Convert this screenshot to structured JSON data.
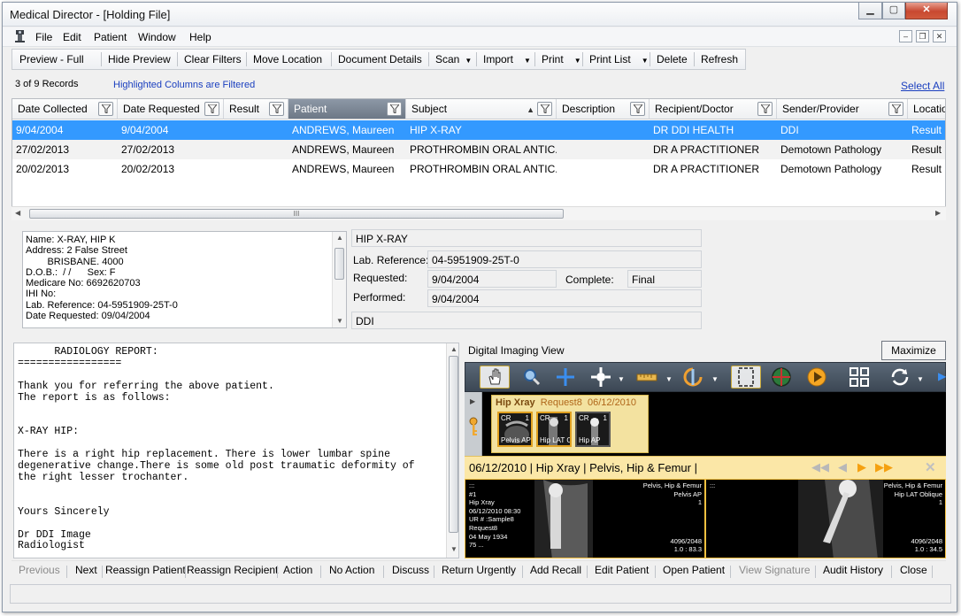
{
  "window": {
    "title": "Medical Director - [Holding File]"
  },
  "menu": [
    "File",
    "Edit",
    "Patient",
    "Window",
    "Help"
  ],
  "toolbar": {
    "preview": "Preview - Full",
    "hide_preview": "Hide Preview",
    "clear_filters": "Clear Filters",
    "move_location": "Move Location",
    "document_details": "Document Details",
    "scan": "Scan",
    "import": "Import",
    "print": "Print",
    "print_list": "Print List",
    "delete": "Delete",
    "refresh": "Refresh"
  },
  "records": {
    "count_text": "3 of 9 Records",
    "filter_note": "Highlighted Columns are Filtered",
    "select_all": "Select All"
  },
  "grid": {
    "columns": [
      "Date Collected",
      "Date Requested",
      "Result",
      "Patient",
      "Subject",
      "Description",
      "Recipient/Doctor",
      "Sender/Provider",
      "Location"
    ],
    "rows": [
      [
        "9/04/2004",
        "9/04/2004",
        "",
        "ANDREWS, Maureen",
        "HIP X-RAY",
        "",
        "DR DDI HEALTH",
        "DDI",
        "Result"
      ],
      [
        "27/02/2013",
        "27/02/2013",
        "",
        "ANDREWS, Maureen",
        "PROTHROMBIN ORAL ANTIC...",
        "",
        "DR A PRACTITIONER",
        "Demotown Pathology",
        "Result"
      ],
      [
        "20/02/2013",
        "20/02/2013",
        "",
        "ANDREWS, Maureen",
        "PROTHROMBIN ORAL ANTIC...",
        "",
        "DR A PRACTITIONER",
        "Demotown Pathology",
        "Result"
      ]
    ],
    "scroll_grip": "III"
  },
  "patient_info": [
    "Name: X-RAY, HIP K",
    "Address: 2 False Street",
    "        BRISBANE. 4000",
    "D.O.B.:  / /      Sex: F",
    "Medicare No: 6692620703",
    "IHI No:",
    "Lab. Reference: 04-5951909-25T-0",
    "Date Requested: 09/04/2004"
  ],
  "details": {
    "subject": "HIP X-RAY",
    "lab_ref_label": "Lab. Reference:",
    "lab_ref": "04-5951909-25T-0",
    "requested_label": "Requested:",
    "requested": "9/04/2004",
    "complete_label": "Complete:",
    "complete": "Final",
    "performed_label": "Performed:",
    "performed": "9/04/2004",
    "provider": "DDI"
  },
  "report": "      RADIOLOGY REPORT:\n=================\n\nThank you for referring the above patient.\nThe report is as follows:\n\n\nX-RAY HIP:\n\nThere is a right hip replacement. There is lower lumbar spine\ndegenerative change.There is some old post traumatic deformity of\nthe right lesser trochanter.\n\n\nYours Sincerely\n\nDr DDI Image\nRadiologist",
  "imaging": {
    "label": "Digital Imaging View",
    "maximize": "Maximize",
    "series_title": "Hip Xray",
    "series_request": "Request8",
    "series_date": "06/12/2010",
    "thumbs": [
      {
        "mod": "CR",
        "num": "1",
        "caption": "Pelvis AP"
      },
      {
        "mod": "CR",
        "num": "1",
        "caption": "Hip LAT O"
      },
      {
        "mod": "CR",
        "num": "1",
        "caption": "Hip AP"
      }
    ],
    "viewer_caption": "06/12/2010 | Hip Xray | Pelvis, Hip & Femur |",
    "left_pane": {
      "tl": [
        ":::",
        "#1",
        "Hip Xray",
        "06/12/2010 08:30",
        "UR # :Sample8",
        "Request8",
        "04 May 1934",
        "75 ..."
      ],
      "tr": [
        "Pelvis, Hip & Femur",
        "Pelvis AP",
        "1"
      ],
      "br": [
        "4096/2048",
        "1.0 : 83.3"
      ]
    },
    "right_pane": {
      "tl": [
        ":::"
      ],
      "tr": [
        "Pelvis, Hip & Femur",
        "Hip LAT Oblique",
        "1"
      ],
      "br": [
        "4096/2048",
        "1.0 : 34.5"
      ]
    }
  },
  "actions": [
    "Previous",
    "Next",
    "Reassign Patient",
    "Reassign Recipient",
    "Action",
    "No Action",
    "Discuss",
    "Return Urgently",
    "Add Recall",
    "Edit Patient",
    "Open Patient",
    "View Signature",
    "Audit History",
    "Close"
  ],
  "disabled_actions": [
    "Previous",
    "View Signature"
  ],
  "colors": {
    "selection": "#3399ff",
    "link": "#1a3fbf",
    "series_panel": "#f3e2a0",
    "viewer_header": "#fbe7a7"
  },
  "icons": [
    "app-icon",
    "pan-hand-icon",
    "zoom-icon",
    "crosshair-icon",
    "window-level-icon",
    "ruler-icon",
    "rotate-icon",
    "fit-frame-icon",
    "globe-icon",
    "play-icon",
    "layout-grid-icon",
    "refresh-icon",
    "key-icon"
  ]
}
